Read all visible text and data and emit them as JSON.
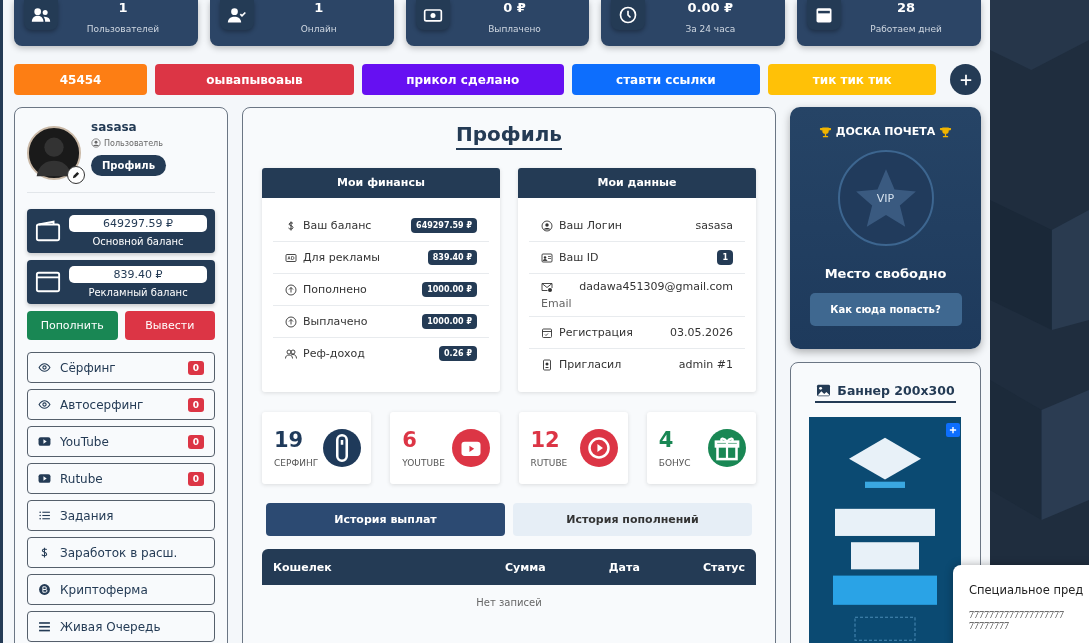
{
  "stats": [
    {
      "value": "1",
      "label": "Пользователей"
    },
    {
      "value": "1",
      "label": "Онлайн"
    },
    {
      "value": "0 ₽",
      "label": "Выплачено"
    },
    {
      "value": "0.00 ₽",
      "label": "За 24 часа"
    },
    {
      "value": "28",
      "label": "Работаем дней"
    }
  ],
  "quick_links": [
    {
      "label": "45454",
      "color": "#fd7e14"
    },
    {
      "label": "оывапывоаыв",
      "color": "#dc3545"
    },
    {
      "label": "прикол сделано",
      "color": "#6610f2"
    },
    {
      "label": "ставти ссылки",
      "color": "#0d6efd"
    },
    {
      "label": "тик тик тик",
      "color": "#ffc107"
    }
  ],
  "profile": {
    "username": "sasasa",
    "role": "Пользователь",
    "button": "Профиль"
  },
  "balances": [
    {
      "amount": "649297.59 ₽",
      "label": "Основной баланс"
    },
    {
      "amount": "839.40 ₽",
      "label": "Рекламный баланс"
    }
  ],
  "actions": [
    {
      "label": "Пополнить",
      "color": "#198754"
    },
    {
      "label": "Вывести",
      "color": "#dc3545"
    }
  ],
  "nav": [
    {
      "label": "Сёрфинг",
      "badge": "0"
    },
    {
      "label": "Автосерфинг",
      "badge": "0"
    },
    {
      "label": "YouTube",
      "badge": "0"
    },
    {
      "label": "Rutube",
      "badge": "0"
    },
    {
      "label": "Задания"
    },
    {
      "label": "Заработок в расш."
    },
    {
      "label": "Криптоферма"
    },
    {
      "label": "Живая Очередь"
    }
  ],
  "page_title": "Профиль",
  "finances": {
    "title": "Мои финансы",
    "rows": [
      {
        "label": "Ваш баланс",
        "value": "649297.59 ₽"
      },
      {
        "label": "Для рекламы",
        "value": "839.40 ₽"
      },
      {
        "label": "Пополнено",
        "value": "1000.00 ₽"
      },
      {
        "label": "Выплачено",
        "value": "1000.00 ₽"
      },
      {
        "label": "Реф-доход",
        "value": "0.26 ₽"
      }
    ]
  },
  "my_data": {
    "title": "Мои данные",
    "rows": [
      {
        "label": "Ваш Логин",
        "value": "sasasa",
        "kind": "text"
      },
      {
        "label": "Ваш ID",
        "value": "1",
        "kind": "badge"
      },
      {
        "label": "Email",
        "value": "dadawa451309@gmail.com",
        "kind": "stacked"
      },
      {
        "label": "Регистрация",
        "value": "03.05.2026",
        "kind": "text"
      },
      {
        "label": "Пригласил",
        "value": "admin #1",
        "kind": "text"
      }
    ]
  },
  "counters": [
    {
      "value": "19",
      "label": "СЕРФИНГ",
      "color": "#1f3a5a"
    },
    {
      "value": "6",
      "label": "YOUTUBE",
      "color": "#dc3545"
    },
    {
      "value": "12",
      "label": "RUTUBE",
      "color": "#dc3545"
    },
    {
      "value": "4",
      "label": "БОНУС",
      "color": "#198754"
    }
  ],
  "history_tabs": [
    {
      "label": "История выплат",
      "selected": true
    },
    {
      "label": "История пополнений",
      "selected": false
    }
  ],
  "table": {
    "columns": [
      "Кошелек",
      "Сумма",
      "Дата",
      "Статус"
    ],
    "empty": "Нет записей"
  },
  "honor": {
    "title": "ДОСКА ПОЧЕТА",
    "badge": "VIP",
    "status": "Место свободно",
    "button": "Как сюда попасть?"
  },
  "banner": {
    "title": "Баннер 200x300"
  },
  "popup": {
    "title": "Специальное пред",
    "lines": [
      "7777777777777777777",
      "77777777"
    ]
  }
}
